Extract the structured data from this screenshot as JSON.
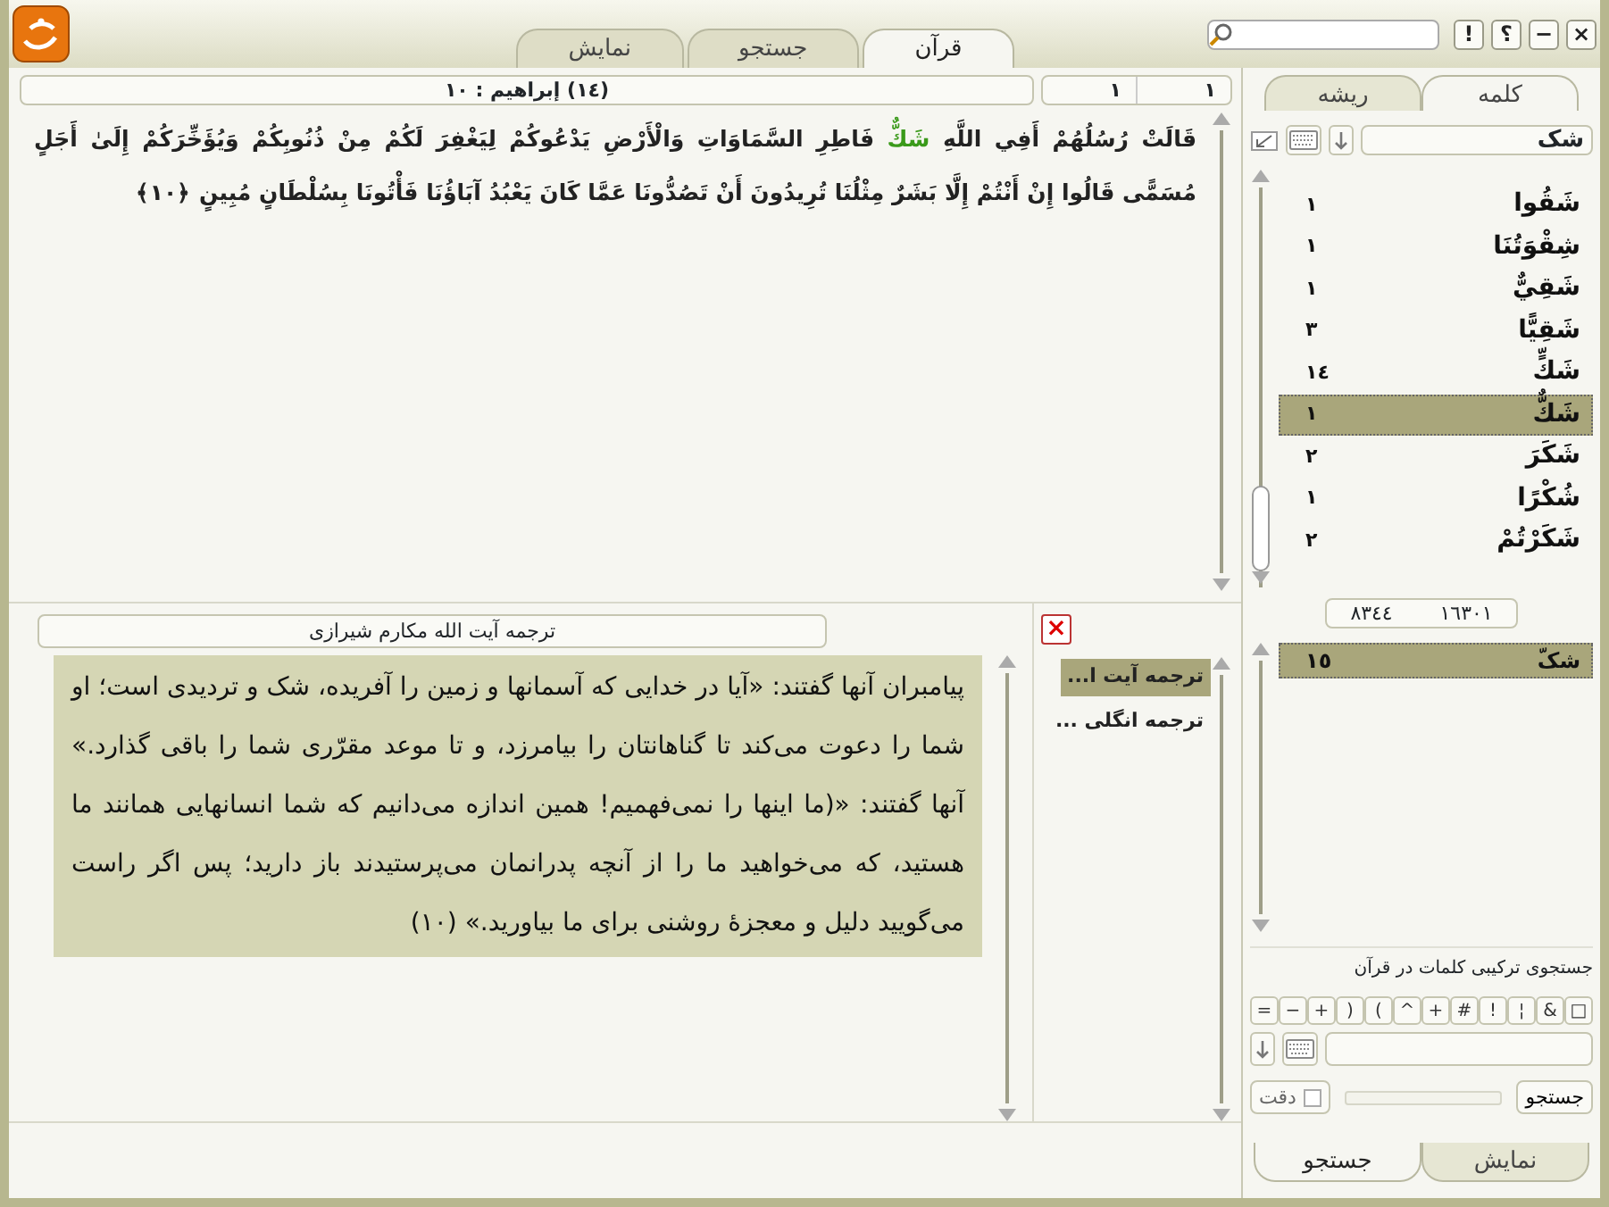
{
  "window": {
    "controls": [
      "×",
      "−",
      "؟",
      "!"
    ]
  },
  "top_tabs": [
    {
      "label": "قرآن",
      "selected": true
    },
    {
      "label": "جستجو",
      "selected": false
    },
    {
      "label": "نمایش",
      "selected": false
    }
  ],
  "verse_header": {
    "title": "(١٤) إبراهيم : ١٠",
    "position_1": "١",
    "position_2": "١"
  },
  "verse": {
    "segments": [
      {
        "text": "قَالَتْ رُسُلُهُمْ أَفِي اللَّهِ ",
        "highlighted": false
      },
      {
        "text": "شَكٌّ",
        "highlighted": true
      },
      {
        "text": " فَاطِرِ السَّمَاوَاتِ وَالْأَرْضِ يَدْعُوكُمْ لِيَغْفِرَ لَكُمْ مِنْ ذُنُوبِكُمْ وَيُؤَخِّرَكُمْ إِلَىٰ أَجَلٍ مُسَمًّى قَالُوا إِنْ أَنْتُمْ إِلَّا بَشَرٌ مِثْلُنَا تُرِيدُونَ أَنْ تَصُدُّونَا عَمَّا كَانَ يَعْبُدُ آبَاؤُنَا فَأْتُونَا بِسُلْطَانٍ مُبِينٍ ﴿١٠﴾",
        "highlighted": false
      }
    ]
  },
  "translation": {
    "title": "ترجمه آیت الله مکارم شیرازی",
    "text": "پیامبران آنها گفتند: «آیا در خدایی که آسمانها و زمین را آفریده، شک و تردیدی است؛ او شما را دعوت می‌کند تا گناهانتان را بیامرزد، و تا موعد مقرّری شما را باقی گذارد.» آنها گفتند: «(ما اینها را نمی‌فهمیم! همین اندازه می‌دانیم که شما انسانهایی همانند ما هستید، که می‌خواهید ما را از آنچه پدرانمان می‌پرستیدند باز دارید؛ پس اگر راست می‌گویید دلیل و معجزهٔ روشنی برای ما بیاورید.» (١٠)"
  },
  "translations": {
    "close": "×",
    "items": [
      {
        "label": "ترجمه آیت ا...",
        "selected": true
      },
      {
        "label": "ترجمه انگلی ...",
        "selected": false
      }
    ]
  },
  "sidebar": {
    "tabs": [
      {
        "label": "کلمه",
        "selected": true
      },
      {
        "label": "ریشه",
        "selected": false
      }
    ],
    "query": "شک",
    "words": [
      {
        "word": "شَقُوا",
        "count": "١",
        "selected": false
      },
      {
        "word": "شِقْوَتُنَا",
        "count": "١",
        "selected": false
      },
      {
        "word": "شَقِيٌّ",
        "count": "١",
        "selected": false
      },
      {
        "word": "شَقِيًّا",
        "count": "٣",
        "selected": false
      },
      {
        "word": "شَكٍّ",
        "count": "١٤",
        "selected": false
      },
      {
        "word": "شَكٌّ",
        "count": "١",
        "selected": true
      },
      {
        "word": "شَكَرَ",
        "count": "٢",
        "selected": false
      },
      {
        "word": "شُكْرًا",
        "count": "١",
        "selected": false
      },
      {
        "word": "شَكَرْتُمْ",
        "count": "٢",
        "selected": false
      }
    ],
    "counter": {
      "total": "١٦٣٠١",
      "found": "٨٣٤٤"
    },
    "roots": [
      {
        "word": "شکّ",
        "count": "١٥",
        "selected": true
      }
    ],
    "combo_label": "جستجوی ترکیبی کلمات در قرآن",
    "operators": [
      "□",
      "&",
      "¦",
      "!",
      "#",
      "+",
      "^",
      ")",
      "(",
      "+",
      "−",
      "="
    ],
    "search_button": "جستجو",
    "progress": {
      "level": 0
    },
    "exact": {
      "label": "دقت",
      "checked": false
    },
    "bottom_tabs": [
      {
        "label": "نمایش",
        "selected": false
      },
      {
        "label": "جستجو",
        "selected": true
      }
    ]
  }
}
